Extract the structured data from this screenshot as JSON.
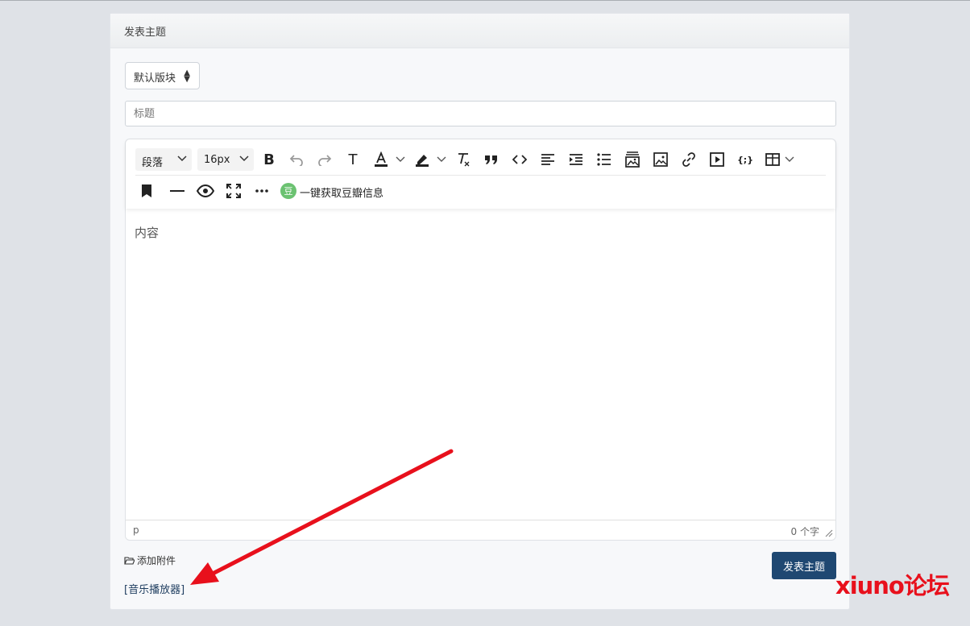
{
  "card": {
    "header_title": "发表主题"
  },
  "forum_select": {
    "value": "默认版块"
  },
  "title_input": {
    "placeholder": "标题"
  },
  "toolbar": {
    "paragraph_label": "段落",
    "fontsize_label": "16px",
    "douban_badge": "豆",
    "douban_label": "一键获取豆瓣信息",
    "icons": [
      "bold-icon",
      "undo-icon",
      "redo-icon",
      "text-style-icon",
      "font-color-icon",
      "highlight-icon",
      "clear-format-icon",
      "quote-icon",
      "code-icon",
      "align-left-icon",
      "indent-icon",
      "bullet-list-icon",
      "image-gallery-icon",
      "image-icon",
      "link-icon",
      "video-icon",
      "code-block-icon",
      "table-icon",
      "bookmark-icon",
      "horizontal-rule-icon",
      "preview-icon",
      "fullscreen-icon",
      "more-icon"
    ]
  },
  "editor": {
    "placeholder": "内容"
  },
  "statusbar": {
    "path": "p",
    "word_count": "0 个字"
  },
  "attachment": {
    "label": "添加附件"
  },
  "music_player": {
    "label": "[音乐播放器]"
  },
  "submit": {
    "label": "发表主题"
  },
  "watermark": {
    "text": "xiuno论坛"
  },
  "colors": {
    "primary": "#1f4872",
    "douban": "#6bc271",
    "annotation": "#e8101c"
  }
}
